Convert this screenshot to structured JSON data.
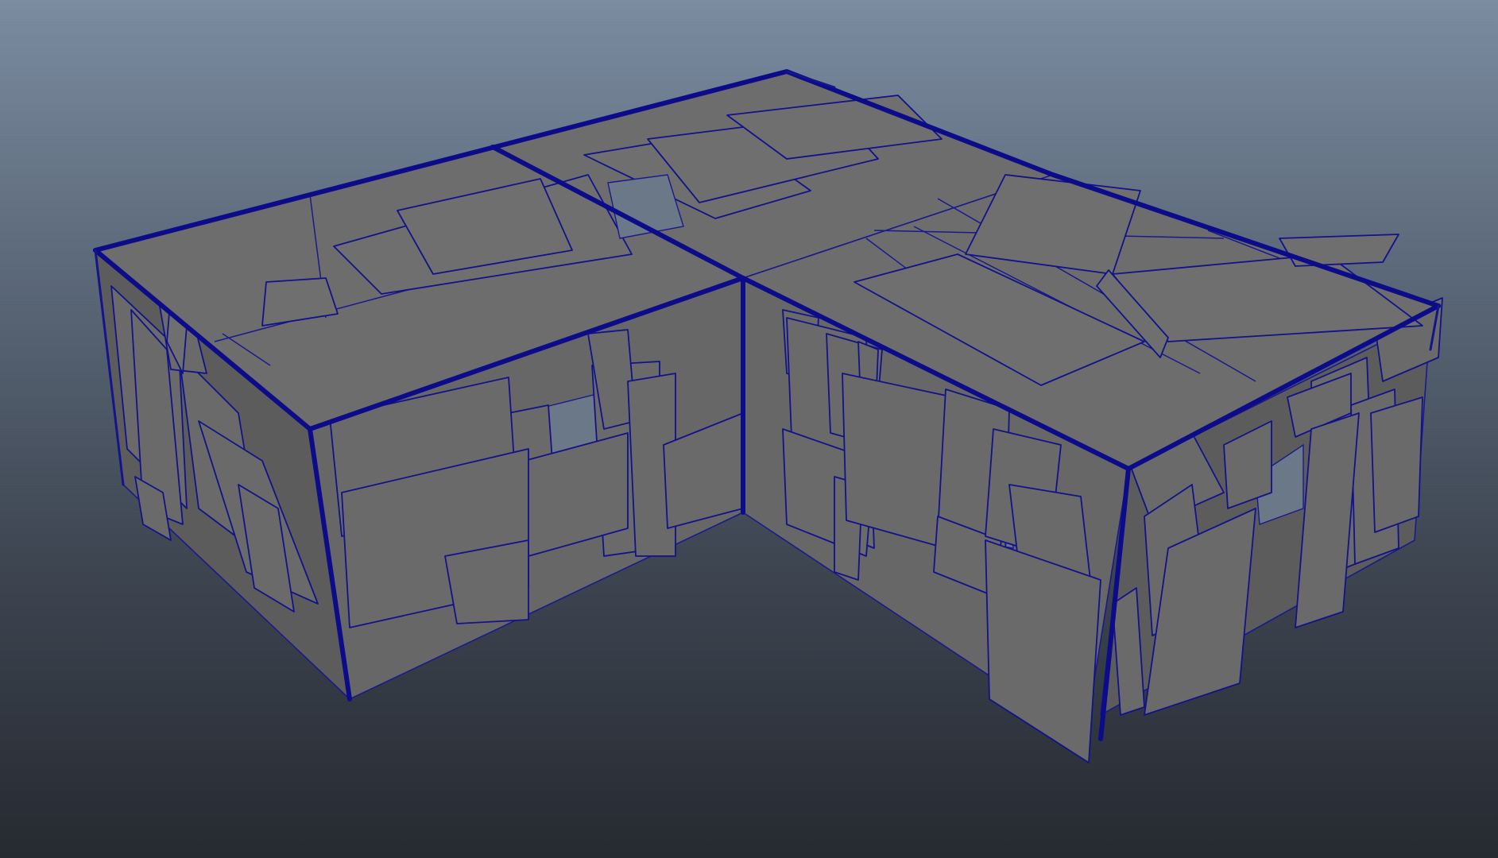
{
  "viewport": {
    "background_top": "#7b8ba0",
    "background_bottom": "#262a31",
    "wireframe_color": "#1a1a8c",
    "surface_color": "#676767"
  }
}
